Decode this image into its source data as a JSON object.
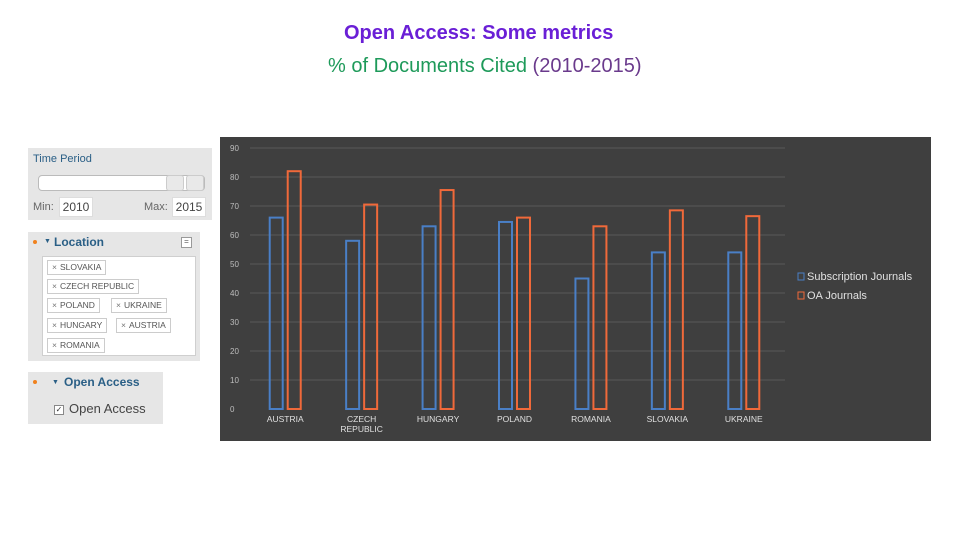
{
  "header": {
    "title": "Open Access: Some metrics",
    "subtitle_main": "% of Documents Cited",
    "subtitle_period": "(2010-2015)"
  },
  "filters": {
    "time_period": {
      "label": "Time Period",
      "min_label": "Min:",
      "min_value": "2010",
      "max_label": "Max:",
      "max_value": "2015"
    },
    "location": {
      "label": "Location",
      "menu_icon": "menu-icon",
      "remove_icon": "×",
      "tags": [
        "SLOVAKIA",
        "CZECH REPUBLIC",
        "POLAND",
        "UKRAINE",
        "HUNGARY",
        "AUSTRIA",
        "ROMANIA"
      ]
    },
    "open_access": {
      "label": "Open Access",
      "checkbox_label": "Open Access",
      "checked": true
    }
  },
  "colors": {
    "subscription": "#4a7fc6",
    "oa": "#f0693a",
    "chart_bg": "#3f3f3f",
    "title": "#6a1fd6",
    "subtitle": "#1e9a5a"
  },
  "chart_data": {
    "type": "bar",
    "title": "% of Documents Cited (2010-2015)",
    "xlabel": "",
    "ylabel": "",
    "ylim": [
      0,
      90
    ],
    "yticks": [
      0,
      10,
      20,
      30,
      40,
      50,
      60,
      70,
      80,
      90
    ],
    "grid": true,
    "legend": "right",
    "categories": [
      "AUSTRIA",
      "CZECH REPUBLIC",
      "HUNGARY",
      "POLAND",
      "ROMANIA",
      "SLOVAKIA",
      "UKRAINE"
    ],
    "category_lines": [
      [
        "AUSTRIA"
      ],
      [
        "CZECH",
        "REPUBLIC"
      ],
      [
        "HUNGARY"
      ],
      [
        "POLAND"
      ],
      [
        "ROMANIA"
      ],
      [
        "SLOVAKIA"
      ],
      [
        "UKRAINE"
      ]
    ],
    "series": [
      {
        "name": "Subscription Journals",
        "values": [
          66,
          58,
          63,
          64.5,
          45,
          54,
          54
        ]
      },
      {
        "name": "OA Journals",
        "values": [
          82,
          70.5,
          75.5,
          66,
          63,
          68.5,
          66.5
        ]
      }
    ]
  }
}
